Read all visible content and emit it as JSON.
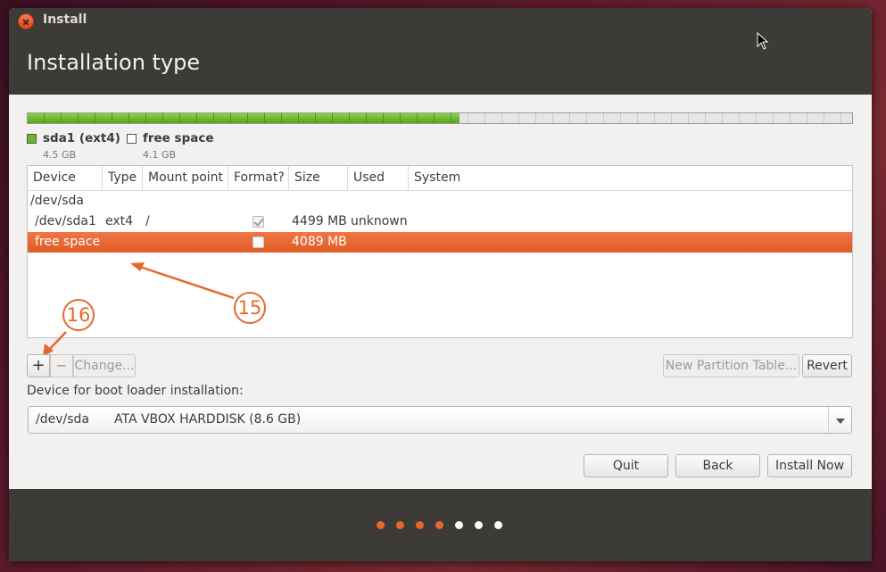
{
  "window": {
    "title": "Install"
  },
  "page": {
    "title": "Installation type"
  },
  "usage_bar": {
    "used_fraction": 0.524,
    "fill_color": "#6ab82a"
  },
  "legend": [
    {
      "name": "sda1 (ext4)",
      "size": "4.5 GB",
      "color": "#6ab82a"
    },
    {
      "name": "free space",
      "size": "4.1 GB",
      "color": "#ffffff"
    }
  ],
  "table": {
    "columns": [
      "Device",
      "Type",
      "Mount point",
      "Format?",
      "Size",
      "Used",
      "System"
    ],
    "rows": [
      {
        "device": "/dev/sda",
        "type": "",
        "mount": "",
        "format": null,
        "size": "",
        "used": "",
        "system": ""
      },
      {
        "device": "/dev/sda1",
        "type": "ext4",
        "mount": "/",
        "format": true,
        "size": "4499 MB",
        "used": "unknown",
        "system": ""
      },
      {
        "device": "free space",
        "type": "",
        "mount": "",
        "format": false,
        "size": "4089 MB",
        "used": "",
        "system": "",
        "selected": true
      }
    ]
  },
  "annotations": {
    "a15": "15",
    "a16": "16",
    "color": "#e4692d"
  },
  "toolbar": {
    "add": "+",
    "remove": "−",
    "change": "Change...",
    "new_table": "New Partition Table...",
    "revert": "Revert"
  },
  "boot": {
    "label": "Device for boot loader installation:",
    "device": "/dev/sda",
    "description": "ATA VBOX HARDDISK (8.6 GB)"
  },
  "buttons": {
    "quit": "Quit",
    "back": "Back",
    "install": "Install Now"
  },
  "progress_dots": {
    "total": 7,
    "completed": 4,
    "active_color": "#e4692d",
    "inactive_color": "#ffffff"
  },
  "colors": {
    "accent": "#e05a24",
    "titlebar": "#3c3b37"
  }
}
